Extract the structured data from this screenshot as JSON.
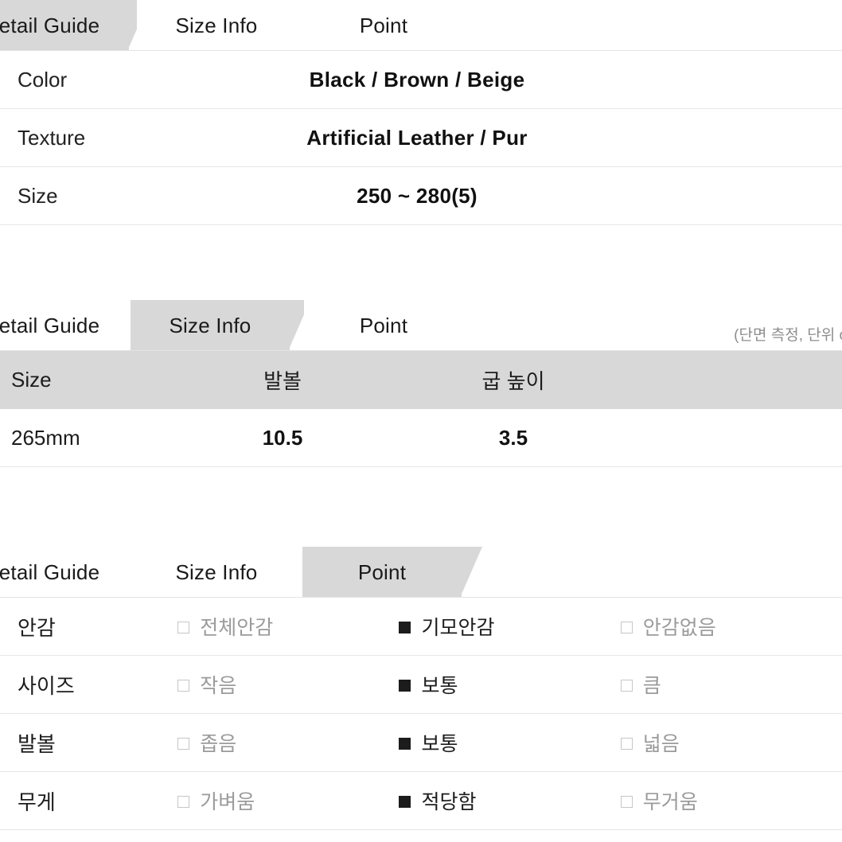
{
  "tabs": [
    "etail Guide",
    "Size Info",
    "Point"
  ],
  "section1": {
    "active_tab": "etail Guide",
    "rows": [
      {
        "label": "Color",
        "value": "Black / Brown / Beige"
      },
      {
        "label": "Texture",
        "value": "Artificial Leather / Pur"
      },
      {
        "label": "Size",
        "value": "250 ~ 280(5)"
      }
    ]
  },
  "section2": {
    "active_tab": "Size Info",
    "note": "(단면 측정, 단위 c",
    "headers": [
      "Size",
      "발볼",
      "굽 높이"
    ],
    "rows": [
      {
        "size": "265mm",
        "width": "10.5",
        "heel": "3.5"
      }
    ]
  },
  "section3": {
    "active_tab": "Point",
    "rows": [
      {
        "label": "안감",
        "options": [
          {
            "text": "전체안감",
            "checked": false
          },
          {
            "text": "기모안감",
            "checked": true
          },
          {
            "text": "안감없음",
            "checked": false
          }
        ]
      },
      {
        "label": "사이즈",
        "options": [
          {
            "text": "작음",
            "checked": false
          },
          {
            "text": "보통",
            "checked": true
          },
          {
            "text": "큼",
            "checked": false
          }
        ]
      },
      {
        "label": "발볼",
        "options": [
          {
            "text": "좁음",
            "checked": false
          },
          {
            "text": "보통",
            "checked": true
          },
          {
            "text": "넓음",
            "checked": false
          }
        ]
      },
      {
        "label": "무게",
        "options": [
          {
            "text": "가벼움",
            "checked": false
          },
          {
            "text": "적당함",
            "checked": true
          },
          {
            "text": "무거움",
            "checked": false
          }
        ]
      }
    ]
  },
  "colors": {
    "active_tab_bg": "#d8d8d8",
    "border": "#e6e6e6",
    "muted_text": "#9b9b9b"
  }
}
